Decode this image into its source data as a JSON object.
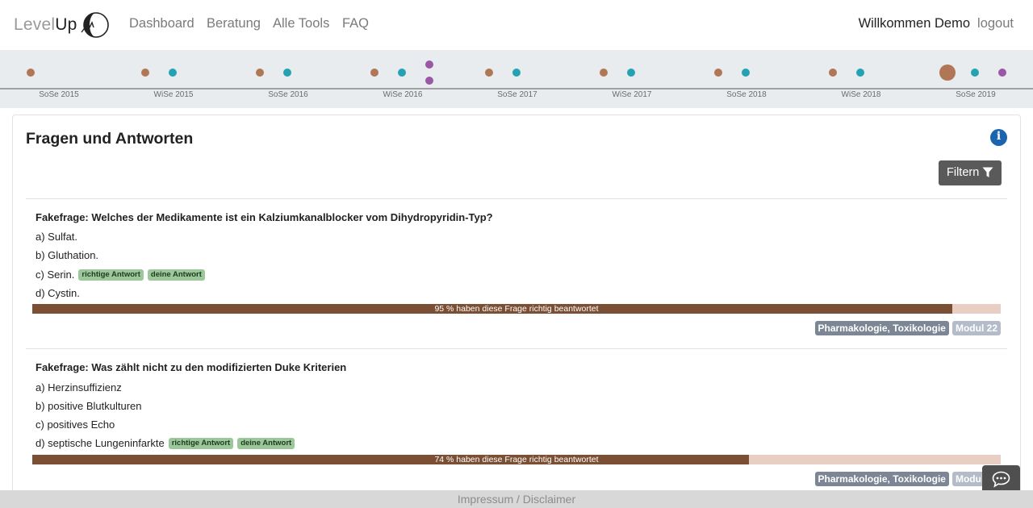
{
  "brand": {
    "light": "Level",
    "dark": "Up"
  },
  "nav": {
    "items": [
      {
        "label": "Dashboard"
      },
      {
        "label": "Beratung"
      },
      {
        "label": "Alle Tools"
      },
      {
        "label": "FAQ"
      }
    ],
    "welcome": "Willkommen Demo",
    "logout": "logout"
  },
  "timeline": {
    "semesters": [
      "SoSe 2015",
      "WiSe 2015",
      "SoSe 2016",
      "WiSe 2016",
      "SoSe 2017",
      "WiSe 2017",
      "SoSe 2018",
      "WiSe 2018",
      "SoSe 2019"
    ],
    "colors": {
      "brown": "#b07656",
      "teal": "#23a3b2",
      "purple": "#9a57a6",
      "axis": "#555555",
      "label": "#6b6b6b"
    }
  },
  "card": {
    "title": "Fragen und Antworten",
    "filter_label": "Filtern",
    "info_icon": "info-circle-icon",
    "filter_icon": "funnel-icon"
  },
  "questions": [
    {
      "title": "Fakefrage: Welches der Medikamente ist ein Kalziumkanalblocker vom Dihydropyridin-Typ?",
      "answers": [
        {
          "text": "a) Sulfat.",
          "badges": []
        },
        {
          "text": "b) Gluthation.",
          "badges": []
        },
        {
          "text": "c) Serin.",
          "badges": [
            "richtige Antwort",
            "deine Antwort"
          ]
        },
        {
          "text": "d) Cystin.",
          "badges": []
        }
      ],
      "percent": 95,
      "progress_text": "95 % haben diese Frage richtig beantwortet",
      "tags": [
        "Pharmakologie, Toxikologie",
        "Modul 22"
      ]
    },
    {
      "title": "Fakefrage: Was zählt nicht zu den modifizierten Duke Kriterien",
      "answers": [
        {
          "text": "a) Herzinsuffizienz",
          "badges": []
        },
        {
          "text": "b) positive Blutkulturen",
          "badges": []
        },
        {
          "text": "c) positives Echo",
          "badges": []
        },
        {
          "text": "d) septische Lungeninfarkte",
          "badges": [
            "richtige Antwort",
            "deine Antwort"
          ]
        }
      ],
      "percent": 74,
      "progress_text": "74 % haben diese Frage richtig beantwortet",
      "tags": [
        "Pharmakologie, Toxikologie",
        "Modul 22"
      ]
    }
  ],
  "footer": {
    "label": "Impressum / Disclaimer"
  },
  "chat": {
    "icon": "chat-bubble-icon"
  }
}
